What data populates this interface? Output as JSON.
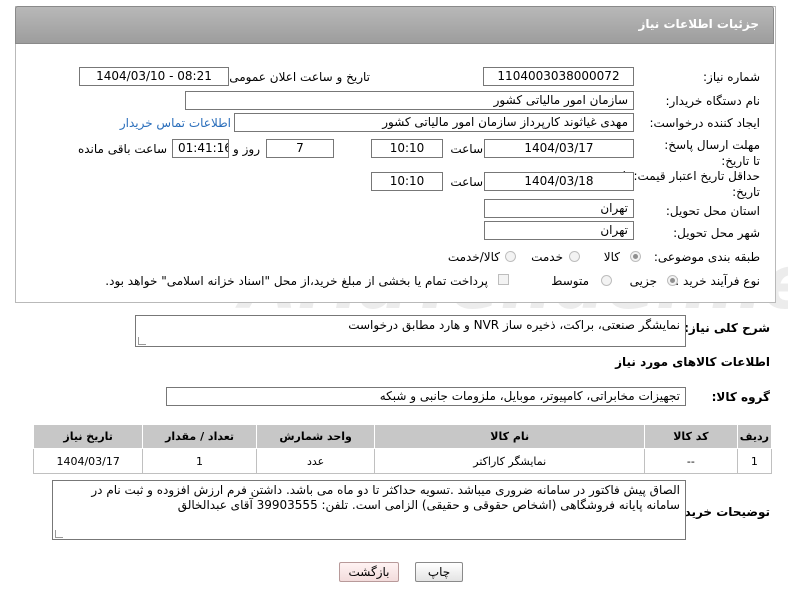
{
  "header": {
    "title": "جزئیات اطلاعات نیاز"
  },
  "fields": {
    "need_number_label": "شماره نیاز:",
    "need_number": "1104003038000072",
    "announce_label": "تاریخ و ساعت اعلان عمومی:",
    "announce_value": "1404/03/10 - 08:21",
    "buyer_org_label": "نام دستگاه خریدار:",
    "buyer_org": "سازمان امور مالیاتی کشور",
    "requester_label": "ایجاد کننده درخواست:",
    "requester": "مهدی غیاثوند کارپرداز سازمان امور مالیاتی کشور",
    "buyer_contact_link": "اطلاعات تماس خریدار",
    "reply_deadline_label": "مهلت ارسال پاسخ: تا تاریخ:",
    "reply_date": "1404/03/17",
    "time_label": "ساعت",
    "reply_time": "10:10",
    "days_value": "7",
    "days_label": "روز و",
    "remaining_time": "01:41:16",
    "remaining_label": "ساعت باقی مانده",
    "price_validity_label": "حداقل تاریخ اعتبار قیمت: تا تاریخ:",
    "price_date": "1404/03/18",
    "price_time": "10:10",
    "province_label": "استان محل تحویل:",
    "province": "تهران",
    "city_label": "شهر محل تحویل:",
    "city": "تهران",
    "category_label": "طبقه بندی موضوعی:",
    "category_options": [
      "کالا",
      "خدمت",
      "کالا/خدمت"
    ],
    "process_label": "نوع فرآیند خرید :",
    "process_options": [
      "جزیی",
      "متوسط"
    ],
    "payment_note": "پرداخت تمام یا بخشی از مبلغ خرید،از محل \"اسناد خزانه اسلامی\" خواهد بود."
  },
  "summary": {
    "label": "شرح کلی نیاز:",
    "text": "نمایشگر صنعتی، براکت، ذخیره ساز NVR و هارد مطابق درخواست"
  },
  "goods_section": {
    "title": "اطلاعات کالاهای مورد نیاز",
    "group_label": "گروه کالا:",
    "group_value": "تجهیزات مخابراتی، کامپیوتر، موبایل، ملزومات جانبی و شبکه"
  },
  "table": {
    "headers": [
      "ردیف",
      "کد کالا",
      "نام کالا",
      "واحد شمارش",
      "تعداد / مقدار",
      "تاریخ نیاز"
    ],
    "rows": [
      [
        "1",
        "--",
        "نمایشگر کاراکتر",
        "عدد",
        "1",
        "1404/03/17"
      ]
    ]
  },
  "buyer_notes": {
    "label": "توضیحات خریدار:",
    "text": "الصاق پیش فاکتور در سامانه ضروری میباشد .تسویه حداکثر تا دو ماه می باشد.  داشتن فرم ارزش افزوده و ثبت نام در سامانه پایانه فروشگاهی (اشخاص حقوقی و حقیقی) الزامی است. تلفن:  39903555 آقای عبدالخالق"
  },
  "buttons": {
    "print": "چاپ",
    "back": "بازگشت"
  },
  "watermark": "AriaTender.net"
}
